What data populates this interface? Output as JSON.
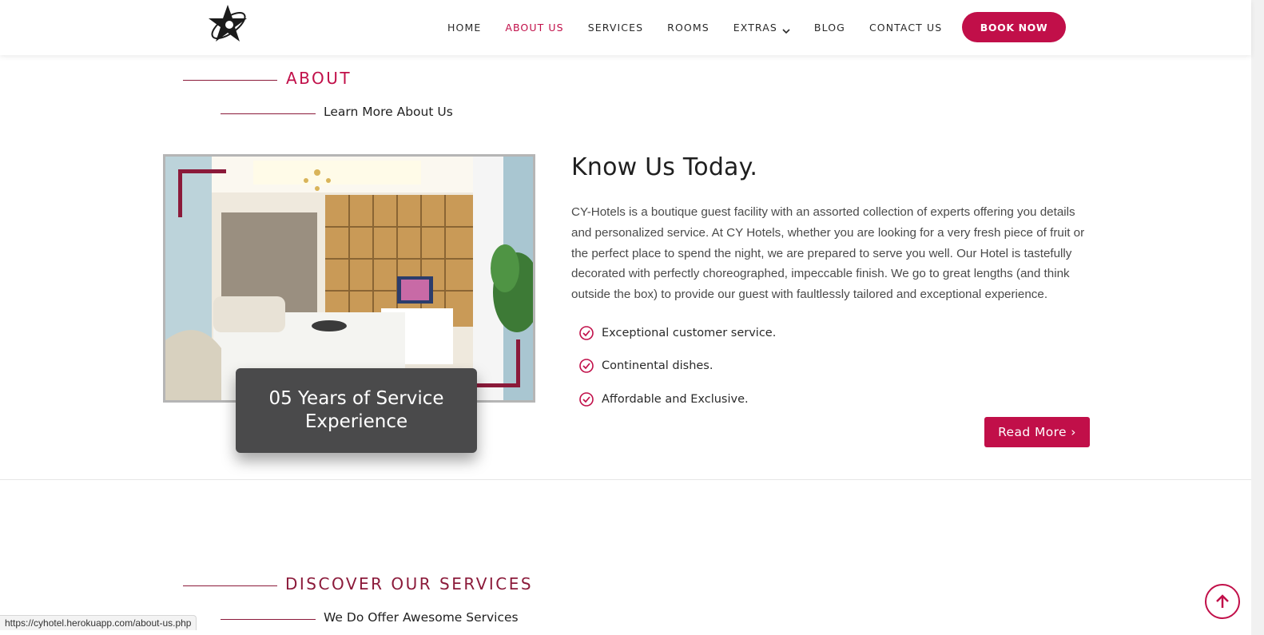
{
  "nav": {
    "items": [
      {
        "label": "HOME",
        "active": false
      },
      {
        "label": "ABOUT US",
        "active": true
      },
      {
        "label": "SERVICES",
        "active": false
      },
      {
        "label": "ROOMS",
        "active": false
      },
      {
        "label": "EXTRAS",
        "active": false,
        "has_dropdown": true
      },
      {
        "label": "BLOG",
        "active": false
      },
      {
        "label": "CONTACT US",
        "active": false
      }
    ],
    "book_label": "BOOK NOW"
  },
  "about": {
    "title": "ABOUT",
    "subtitle": "Learn More About Us",
    "heading": "Know Us Today.",
    "paragraph": "CY-Hotels is a boutique guest facility with an assorted collection of experts offering you details and personalized service. At CY Hotels, whether you are looking for a very fresh piece of fruit or the perfect place to spend the night, we are prepared to serve you well. Our Hotel is tastefully decorated with perfectly choreographed, impeccable finish. We go to great lengths (and think outside the box) to provide our guest with faultlessly tailored and exceptional experience.",
    "features": [
      "Exceptional customer service.",
      "Continental dishes.",
      "Affordable and Exclusive."
    ],
    "experience_card": "05 Years of Service Experience",
    "read_more": "Read More ›"
  },
  "services": {
    "title": "DISCOVER OUR SERVICES",
    "subtitle": "We Do Offer Awesome Services"
  },
  "status_bar": {
    "url": "https://cyhotel.herokuapp.com/about-us.php"
  },
  "colors": {
    "accent": "#c10f49",
    "accent_dark": "#8b1a3a",
    "card": "#4a4a4b"
  },
  "icons": {
    "logo": "star-logo-icon",
    "check": "circle-check-icon",
    "scroll_top": "arrow-up-icon",
    "dropdown": "chevron-down-icon"
  }
}
